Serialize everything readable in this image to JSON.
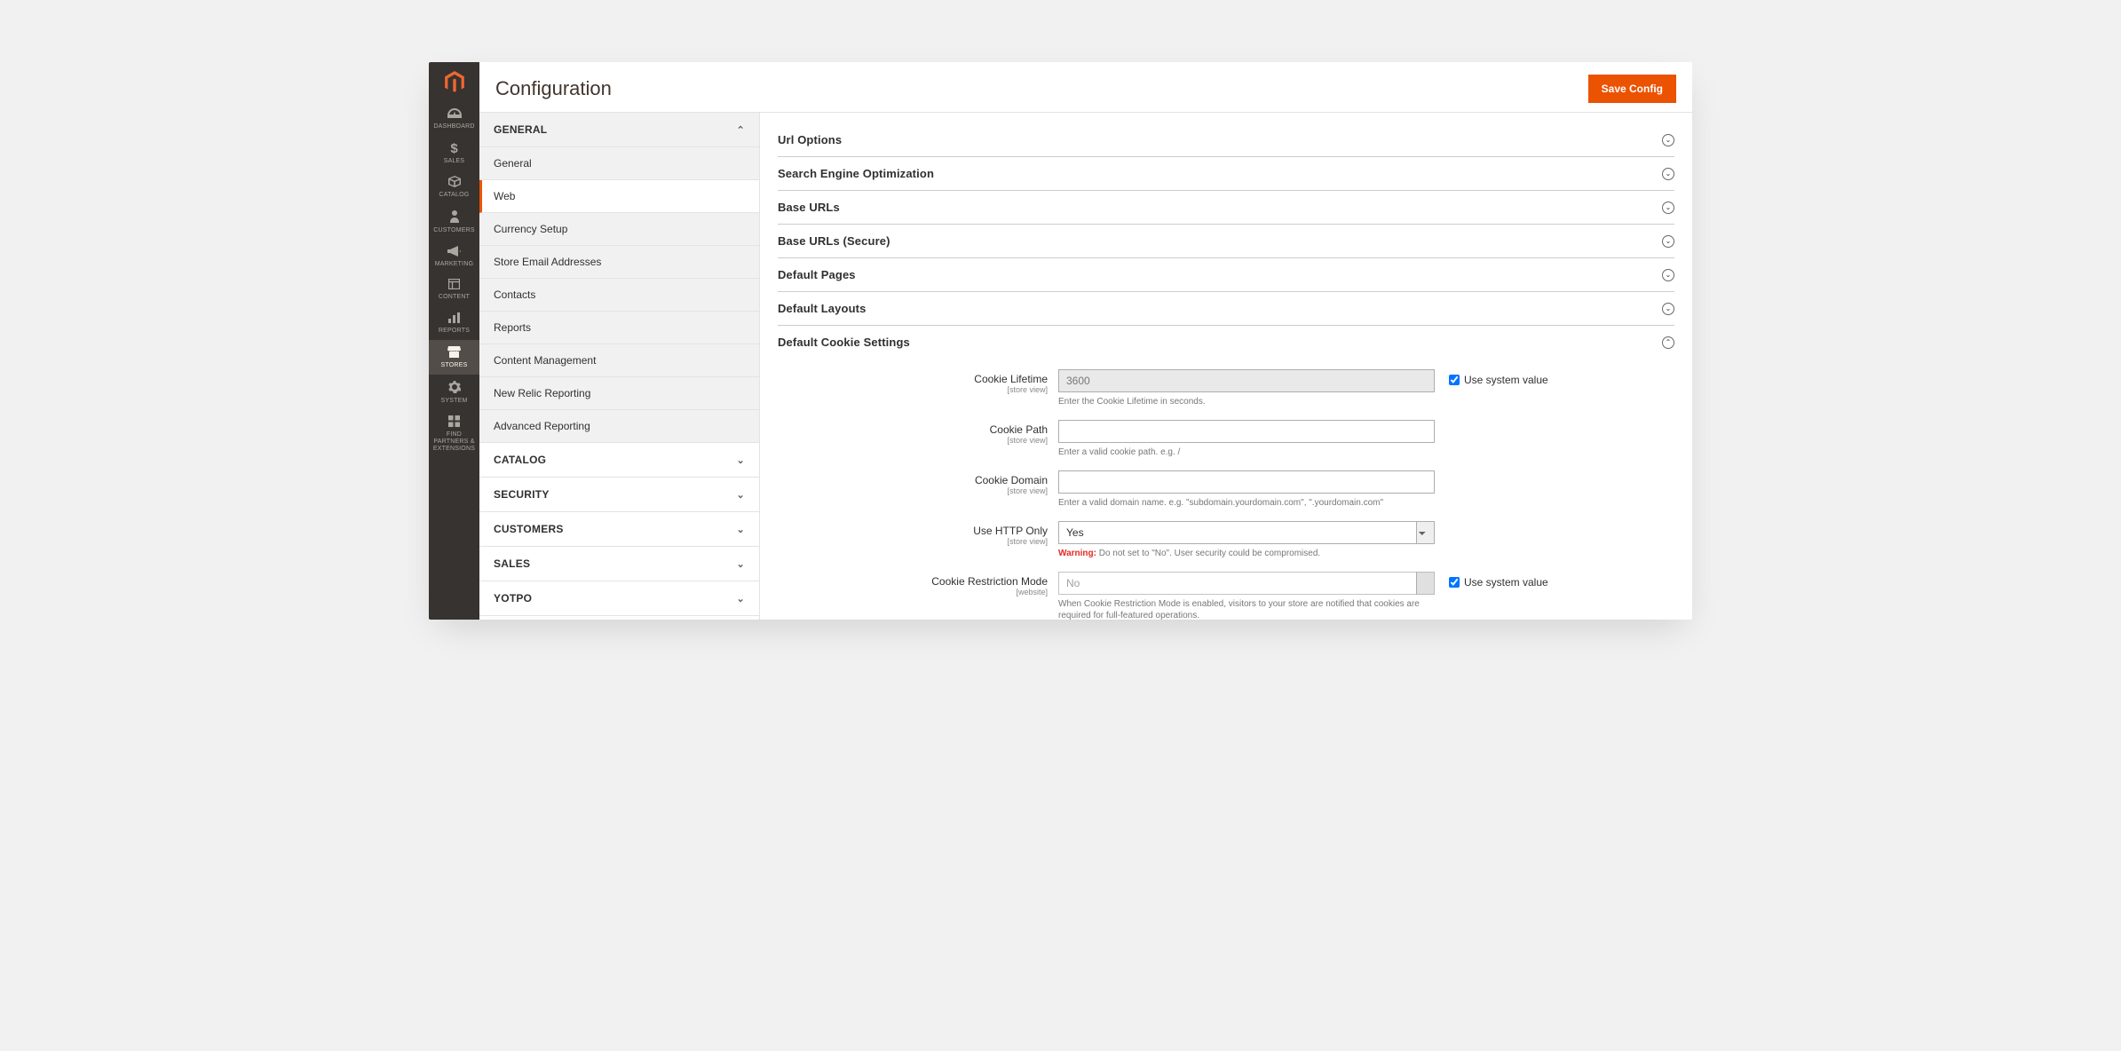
{
  "header": {
    "title": "Configuration",
    "save_label": "Save Config"
  },
  "nav": {
    "items": [
      {
        "label": "DASHBOARD",
        "icon": "dashboard"
      },
      {
        "label": "SALES",
        "icon": "dollar"
      },
      {
        "label": "CATALOG",
        "icon": "box"
      },
      {
        "label": "CUSTOMERS",
        "icon": "person"
      },
      {
        "label": "MARKETING",
        "icon": "megaphone"
      },
      {
        "label": "CONTENT",
        "icon": "layout"
      },
      {
        "label": "REPORTS",
        "icon": "bars"
      },
      {
        "label": "STORES",
        "icon": "store",
        "active": true
      },
      {
        "label": "SYSTEM",
        "icon": "gear"
      },
      {
        "label": "FIND PARTNERS & EXTENSIONS",
        "icon": "blocks"
      }
    ]
  },
  "sidebar": {
    "groups": [
      {
        "label": "GENERAL",
        "expanded": true,
        "items": [
          {
            "label": "General"
          },
          {
            "label": "Web",
            "active": true
          },
          {
            "label": "Currency Setup"
          },
          {
            "label": "Store Email Addresses"
          },
          {
            "label": "Contacts"
          },
          {
            "label": "Reports"
          },
          {
            "label": "Content Management"
          },
          {
            "label": "New Relic Reporting"
          },
          {
            "label": "Advanced Reporting"
          }
        ]
      },
      {
        "label": "CATALOG",
        "expanded": false
      },
      {
        "label": "SECURITY",
        "expanded": false
      },
      {
        "label": "CUSTOMERS",
        "expanded": false
      },
      {
        "label": "SALES",
        "expanded": false
      },
      {
        "label": "YOTPO",
        "expanded": false
      }
    ]
  },
  "sections": {
    "collapsed": [
      {
        "title": "Url Options"
      },
      {
        "title": "Search Engine Optimization"
      },
      {
        "title": "Base URLs"
      },
      {
        "title": "Base URLs (Secure)"
      },
      {
        "title": "Default Pages"
      },
      {
        "title": "Default Layouts"
      }
    ],
    "expanded": {
      "title": "Default Cookie Settings",
      "use_system_label": "Use system value",
      "fields": {
        "cookie_lifetime": {
          "label": "Cookie Lifetime",
          "scope": "[store view]",
          "value": "3600",
          "note": "Enter the Cookie Lifetime in seconds.",
          "use_system": true
        },
        "cookie_path": {
          "label": "Cookie Path",
          "scope": "[store view]",
          "value": "",
          "note": "Enter a valid cookie path. e.g. /"
        },
        "cookie_domain": {
          "label": "Cookie Domain",
          "scope": "[store view]",
          "value": "",
          "note": "Enter a valid domain name. e.g. \"subdomain.yourdomain.com\", \".yourdomain.com\""
        },
        "use_http_only": {
          "label": "Use HTTP Only",
          "scope": "[store view]",
          "value": "Yes",
          "warn_label": "Warning:",
          "note": " Do not set to \"No\". User security could be compromised."
        },
        "cookie_restriction": {
          "label": "Cookie Restriction Mode",
          "scope": "[website]",
          "value": "No",
          "note": "When Cookie Restriction Mode is enabled, visitors to your store are notified that cookies are required for full-featured operations.",
          "use_system": true
        }
      }
    }
  }
}
